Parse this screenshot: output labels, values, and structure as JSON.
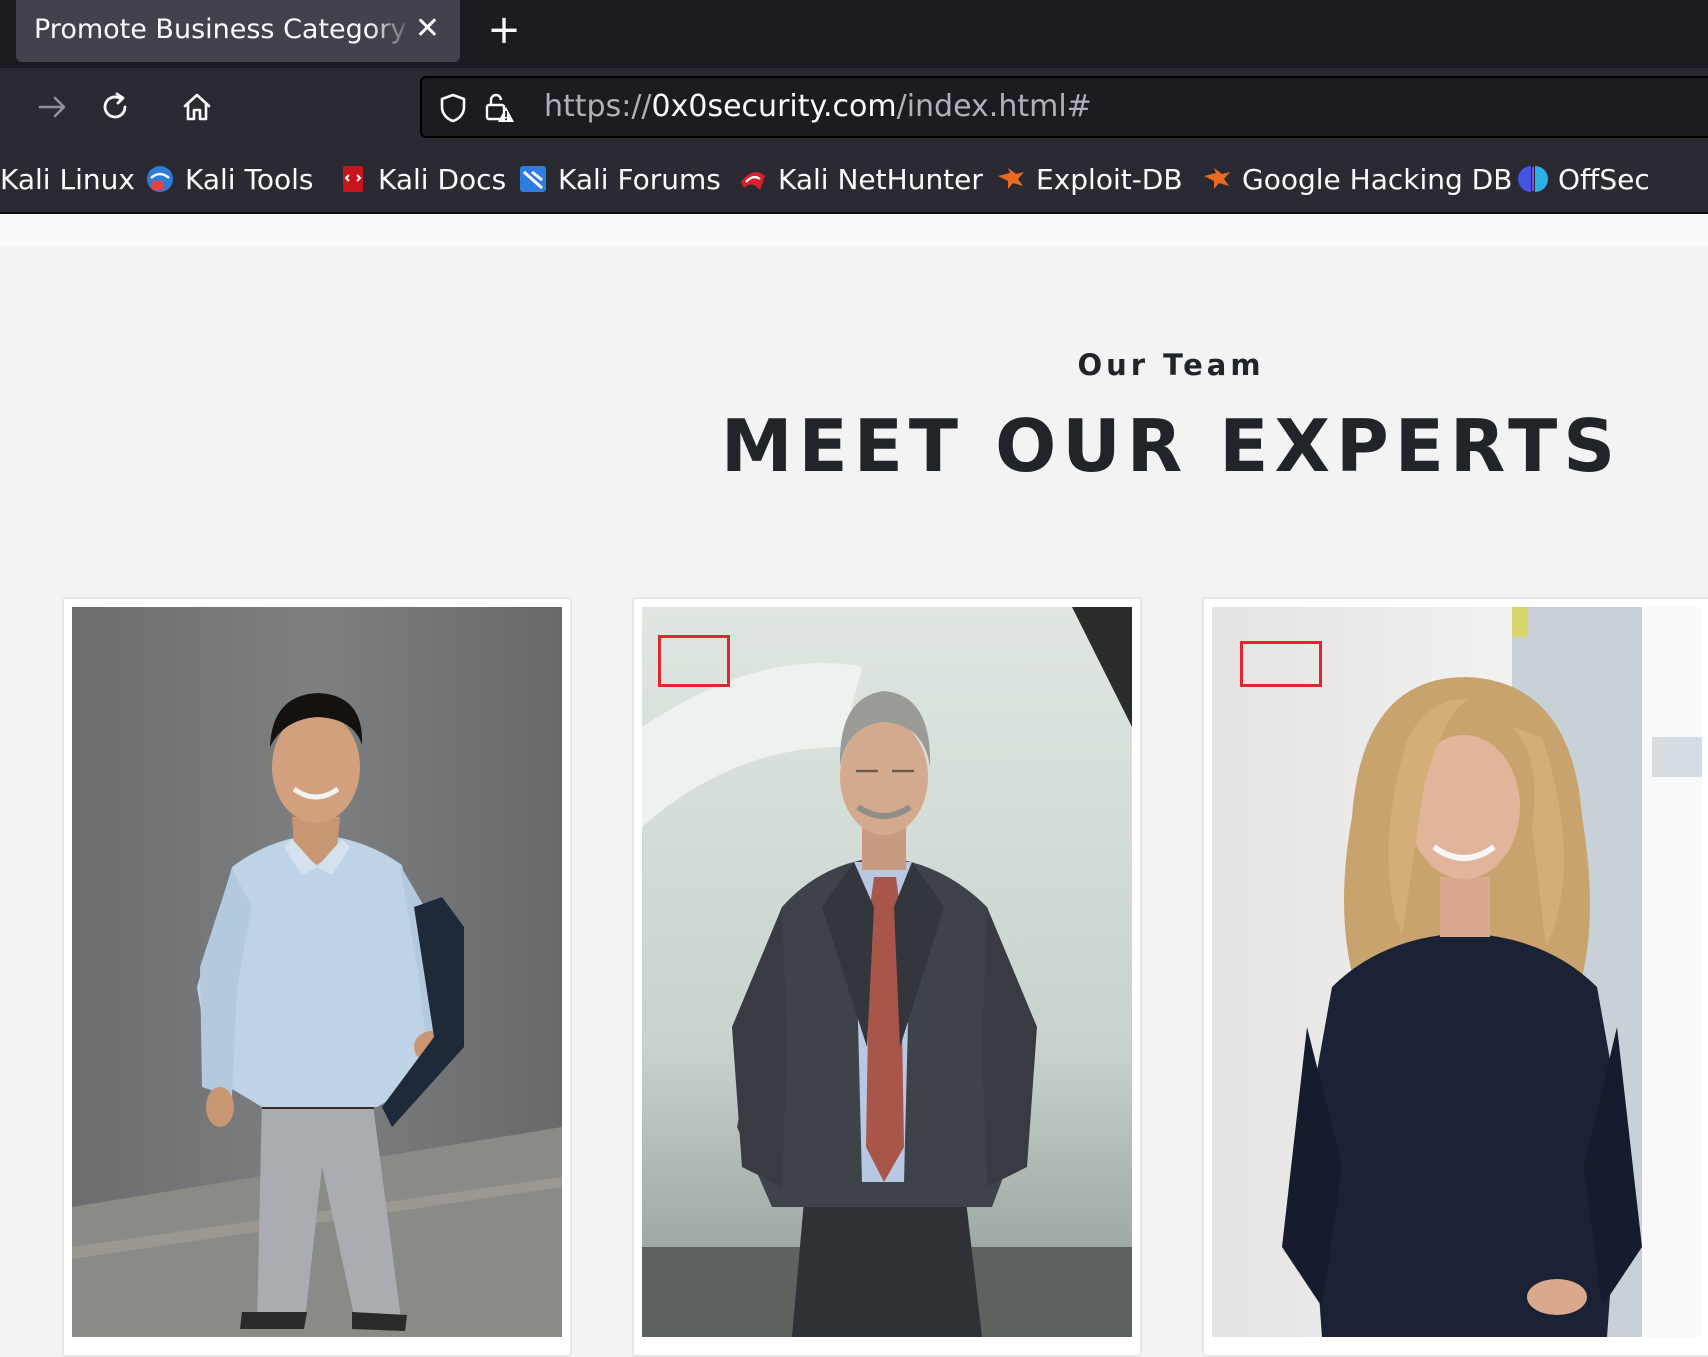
{
  "browser": {
    "tab": {
      "title": "Promote Business Category Ex",
      "close_glyph": "✕",
      "new_tab_glyph": "+"
    },
    "url": {
      "scheme": "https://",
      "host": "0x0security.com",
      "path": "/index.html#"
    },
    "bookmarks": [
      {
        "label": "Kali Linux",
        "icon": "none"
      },
      {
        "label": "Kali Tools",
        "icon": "kali-tools-icon"
      },
      {
        "label": "Kali Docs",
        "icon": "kali-docs-icon"
      },
      {
        "label": "Kali Forums",
        "icon": "kali-forums-icon"
      },
      {
        "label": "Kali NetHunter",
        "icon": "kali-nethunter-icon"
      },
      {
        "label": "Exploit-DB",
        "icon": "exploit-db-icon"
      },
      {
        "label": "Google Hacking DB",
        "icon": "google-hacking-db-icon"
      },
      {
        "label": "OffSec",
        "icon": "offsec-icon"
      }
    ]
  },
  "team": {
    "subtitle": "Our Team",
    "title": "MEET OUR EXPERTS",
    "members": [
      {
        "photo": "smiling man in light blue shirt holding a folder"
      },
      {
        "photo": "grey-haired man in dark suit and tie"
      },
      {
        "photo": "smiling woman with curly blonde hair in navy top"
      }
    ]
  },
  "colors": {
    "tabbar_bg": "#1c1b22",
    "toolbar_bg": "#2b2a33",
    "page_bg": "#f3f3f3",
    "heading": "#212529",
    "highlight_box": "#e3252f"
  }
}
